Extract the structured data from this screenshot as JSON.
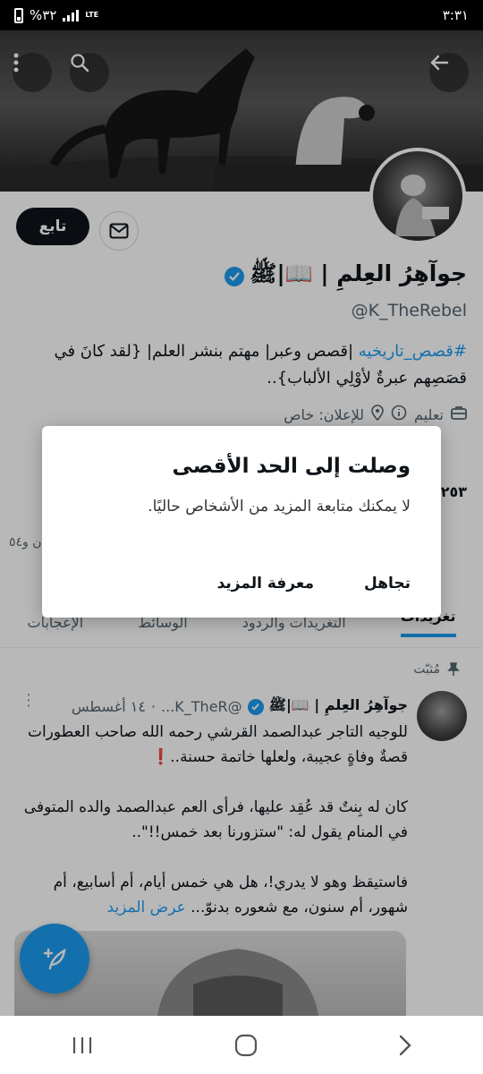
{
  "status_bar": {
    "time": "٣:٣١",
    "battery": "%٣٢",
    "network": "LTE"
  },
  "profile": {
    "name": "جوآهِرُ العِلمِ | 📖|ﷺ",
    "handle": "@K_TheRebel",
    "follow_label": "تابع",
    "bio_hashtag": "#قصص_تاريخيه",
    "bio_text": " |قصص وعبر| مهتم بنشر العلم| {لقد كانَ في قصَصِهم عبرةٌ لأوْلِي الألباب}..",
    "category": "تعليم",
    "location": "للإعلان: خاص",
    "following_count": "٢٥٣",
    "followers_partial": "ن و٥٤"
  },
  "tabs": [
    {
      "label": "تغريدات",
      "active": true
    },
    {
      "label": "التغريدات والردود"
    },
    {
      "label": "الوسائط"
    },
    {
      "label": "الإعجابات"
    }
  ],
  "pinned_label": "مُثبّت",
  "tweet": {
    "author": "جوآهِرُ العِلمِ | 📖|ﷺ",
    "handle": "@K_TheR...",
    "date": "١٤ أغسطس",
    "p1": "للوجيه التاجر عبدالصمد القرشي رحمه الله صاحب العطورات قصةٌ وفاةٍ عجيبة، ولعلها خاتمة حسنة..❗",
    "p2": "كان له بِنتٌ قد عُقِد عليها، فرأى العم عبدالصمد والده المتوفى في المنام يقول له: \"ستزورنا بعد خمس!!\"..",
    "p3": "فاستيقظ وهو لا يدري!، هل هي خمس أيام، أم أسابيع، أم شهور، أم سنون، مع شعوره بدنوّ...",
    "show_more": "عرض المزيد"
  },
  "dialog": {
    "title": "وصلت إلى الحد الأقصى",
    "message": "لا يمكنك متابعة المزيد من الأشخاص حاليًا.",
    "ignore_label": "تجاهل",
    "learn_more_label": "معرفة المزيد"
  },
  "colors": {
    "accent": "#1d9bf0",
    "text": "#0f1419",
    "muted": "#536471"
  }
}
